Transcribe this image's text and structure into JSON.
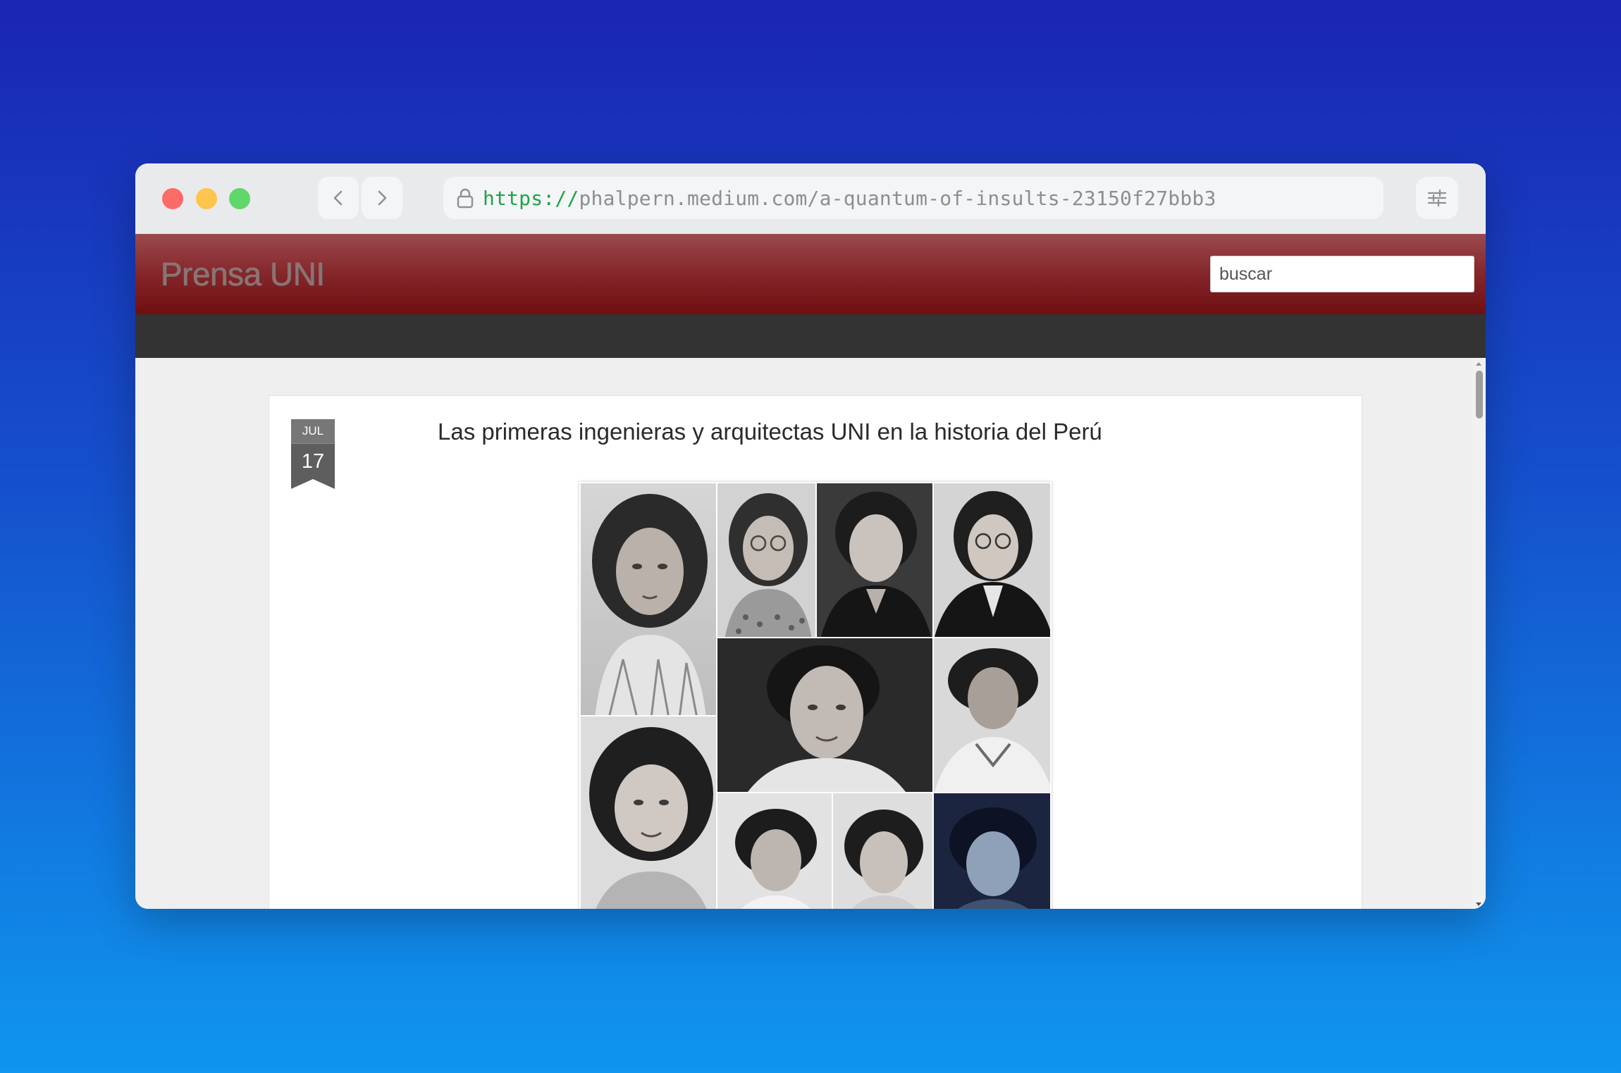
{
  "browser": {
    "url_scheme": "https://",
    "url_rest": "phalpern.medium.com/a-quantum-of-insults-23150f27bbb3",
    "icons": {
      "back": "chevron-left-icon",
      "forward": "chevron-right-icon",
      "lock": "lock-icon",
      "menu": "sliders-icon"
    }
  },
  "site": {
    "title": "Prensa UNI",
    "search_placeholder": "buscar"
  },
  "post": {
    "date_month": "JUL",
    "date_day": "17",
    "title": "Las primeras ingenieras y arquitectas UNI en la historia del Perú",
    "image_description_count": 11
  },
  "colors": {
    "header_top": "#9a4a4e",
    "header_bottom": "#6f0f12",
    "menubar": "#333333",
    "url_scheme": "#1ea34a"
  }
}
